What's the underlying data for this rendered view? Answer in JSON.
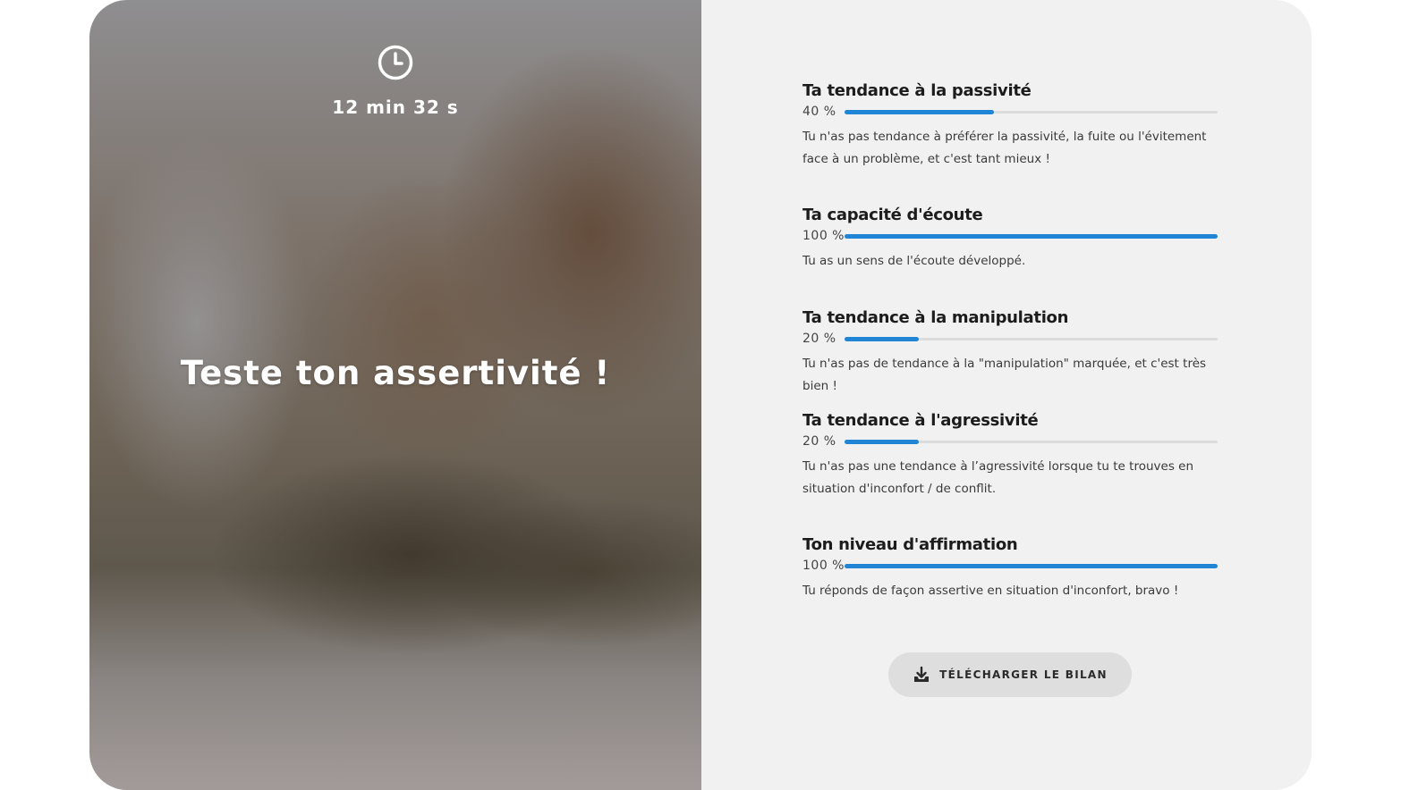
{
  "quiz": {
    "timer": "12 min 32 s",
    "title": "Teste ton assertivité !"
  },
  "results": [
    {
      "title": "Ta tendance à la passivité",
      "percent_label": "40 %",
      "percent": 40,
      "description": "Tu n'as pas tendance à préférer la passivité, la fuite ou l'évitement face à un problème, et c'est tant mieux !"
    },
    {
      "title": "Ta capacité d'écoute",
      "percent_label": "100 %",
      "percent": 100,
      "description": "Tu as un sens de l'écoute développé."
    },
    {
      "title": "Ta tendance à la manipulation",
      "percent_label": "20 %",
      "percent": 20,
      "description": "Tu n'as pas de tendance à la \"manipulation\" marquée, et c'est très bien !"
    },
    {
      "title": "Ta tendance à l'agressivité",
      "percent_label": "20 %",
      "percent": 20,
      "description": "Tu n'as pas une tendance à l’agressivité lorsque tu te trouves en situation d'inconfort / de conflit."
    },
    {
      "title": "Ton niveau d'affirmation",
      "percent_label": "100 %",
      "percent": 100,
      "description": "Tu réponds de façon assertive en situation d'inconfort, bravo !"
    }
  ],
  "download": {
    "label": "TÉLÉCHARGER LE BILAN",
    "icon": "download-icon"
  },
  "icons": {
    "timer": "clock-icon"
  },
  "colors": {
    "accent": "#2185d5",
    "track": "#dcdcdc",
    "panel_background": "#f1f1f2",
    "button_background": "#dedede"
  }
}
